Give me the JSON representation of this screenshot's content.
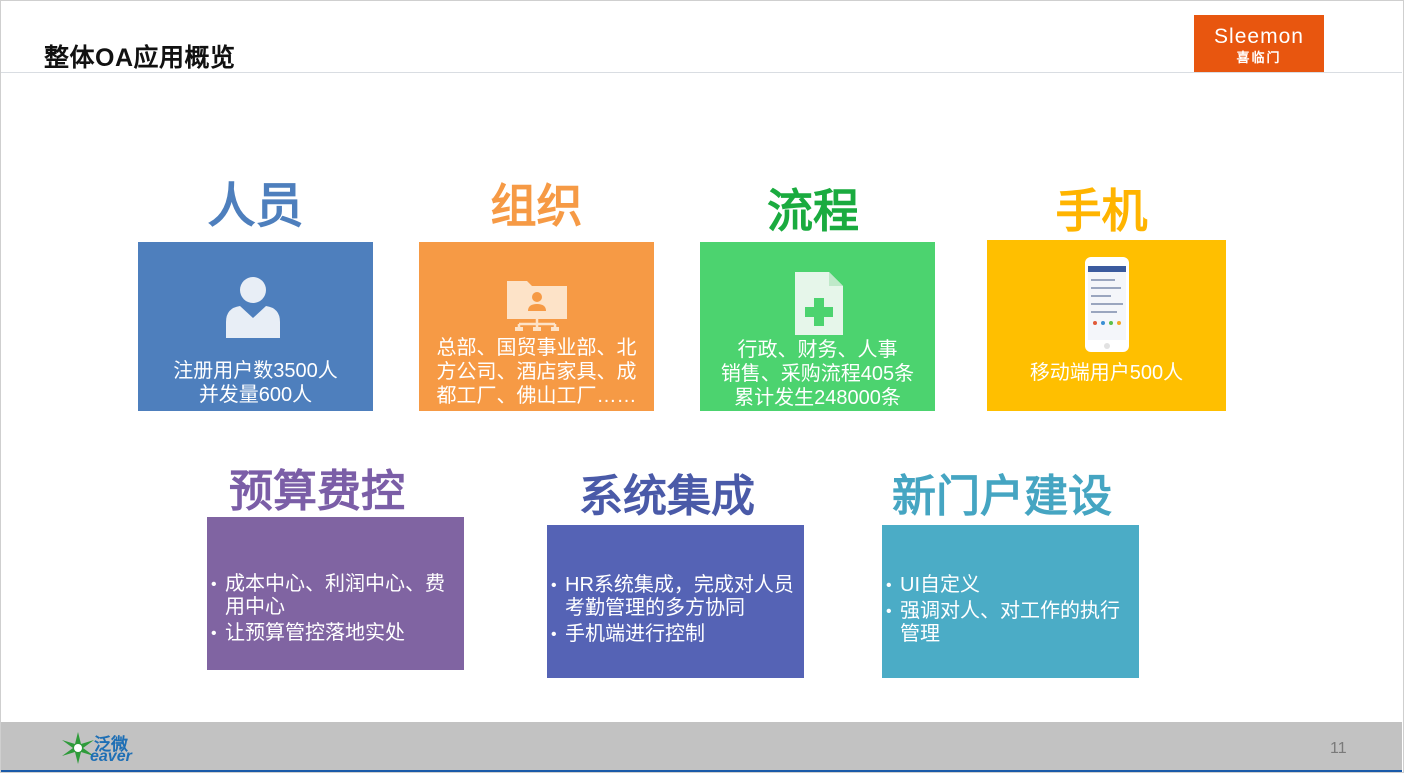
{
  "slide": {
    "title": "整体OA应用概览",
    "page_number": "11"
  },
  "brand": {
    "logo_en": "Sleemon",
    "logo_cn": "喜临门",
    "logo_color": "#e8560f",
    "footer_logo_cn": "泛微",
    "footer_logo_en": "eaver"
  },
  "cards": {
    "people": {
      "heading": "人员",
      "color": "#4e7fbd",
      "heading_color": "#4e7fbd",
      "icon": "user-icon",
      "line1": "注册用户数3500人",
      "line2": "并发量600人"
    },
    "org": {
      "heading": "组织",
      "color": "#f69a45",
      "heading_color": "#f69a45",
      "icon": "org-folder-icon",
      "line1": "总部、国贸事业部、北",
      "line2": "方公司、酒店家具、成",
      "line3": "都工厂、佛山工厂……"
    },
    "process": {
      "heading": "流程",
      "color": "#4cd36f",
      "heading_color": "#1aab3f",
      "icon": "add-document-icon",
      "line1": "行政、财务、人事",
      "line2": "销售、采购流程405条",
      "line3": "累计发生248000条"
    },
    "mobile": {
      "heading": "手机",
      "color": "#ffbf00",
      "heading_color": "#ffb400",
      "icon": "phone-icon",
      "line1": "移动端用户500人"
    },
    "budget": {
      "heading": "预算费控",
      "color": "#8064a2",
      "heading_color": "#7b5ea7",
      "items": [
        "成本中心、利润中心、费用中心",
        "让预算管控落地实处"
      ]
    },
    "integration": {
      "heading": "系统集成",
      "color": "#5563b5",
      "heading_color": "#4a5aa8",
      "items": [
        "HR系统集成，完成对人员考勤管理的多方协同",
        "手机端进行控制"
      ]
    },
    "portal": {
      "heading": "新门户建设",
      "color": "#4bacc6",
      "heading_color": "#45a5c2",
      "items": [
        "UI自定义",
        "强调对人、对工作的执行管理"
      ]
    }
  }
}
